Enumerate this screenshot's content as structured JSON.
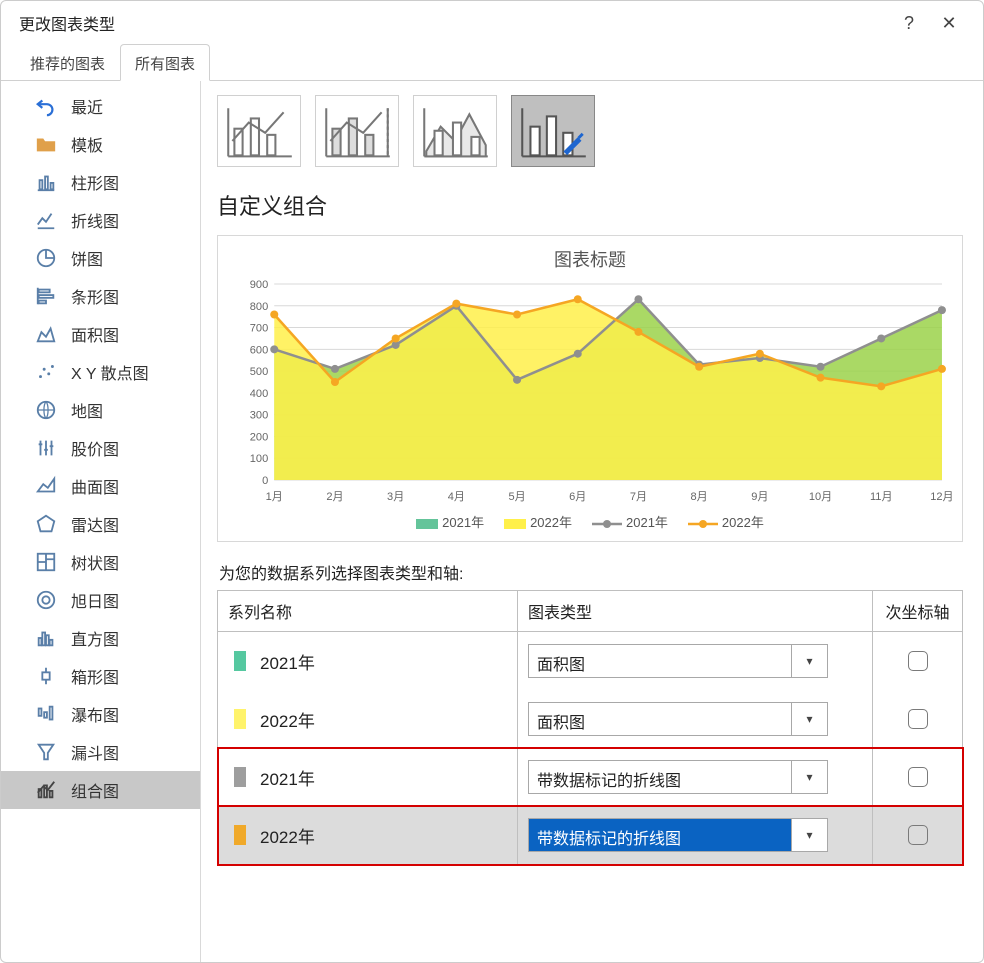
{
  "dialog": {
    "title": "更改图表类型",
    "help": "?",
    "close": "✕"
  },
  "tabs": {
    "recommended": "推荐的图表",
    "all": "所有图表"
  },
  "sidebar": {
    "items": [
      {
        "label": "最近"
      },
      {
        "label": "模板"
      },
      {
        "label": "柱形图"
      },
      {
        "label": "折线图"
      },
      {
        "label": "饼图"
      },
      {
        "label": "条形图"
      },
      {
        "label": "面积图"
      },
      {
        "label": "X Y 散点图"
      },
      {
        "label": "地图"
      },
      {
        "label": "股价图"
      },
      {
        "label": "曲面图"
      },
      {
        "label": "雷达图"
      },
      {
        "label": "树状图"
      },
      {
        "label": "旭日图"
      },
      {
        "label": "直方图"
      },
      {
        "label": "箱形图"
      },
      {
        "label": "瀑布图"
      },
      {
        "label": "漏斗图"
      },
      {
        "label": "组合图"
      }
    ]
  },
  "section_title": "自定义组合",
  "chart_title": "图表标题",
  "table": {
    "caption": "为您的数据系列选择图表类型和轴:",
    "col_name": "系列名称",
    "col_type": "图表类型",
    "col_axis": "次坐标轴",
    "rows": [
      {
        "color": "#55c8a0",
        "name": "2021年",
        "type": "面积图"
      },
      {
        "color": "#fff36b",
        "name": "2022年",
        "type": "面积图"
      },
      {
        "color": "#9e9e9e",
        "name": "2021年",
        "type": "带数据标记的折线图"
      },
      {
        "color": "#f0a92a",
        "name": "2022年",
        "type": "带数据标记的折线图"
      }
    ]
  },
  "chart_data": {
    "type": "combo",
    "title": "图表标题",
    "categories": [
      "1月",
      "2月",
      "3月",
      "4月",
      "5月",
      "6月",
      "7月",
      "8月",
      "9月",
      "10月",
      "11月",
      "12月"
    ],
    "ylim": [
      0,
      900
    ],
    "yticks": [
      0,
      100,
      200,
      300,
      400,
      500,
      600,
      700,
      800,
      900
    ],
    "series": [
      {
        "name": "2021年",
        "style": "area",
        "color": "#9bd24a",
        "values": [
          600,
          510,
          620,
          800,
          460,
          580,
          830,
          530,
          560,
          520,
          650,
          780
        ]
      },
      {
        "name": "2022年",
        "style": "area",
        "color": "#fff04a",
        "values": [
          760,
          450,
          650,
          810,
          760,
          830,
          680,
          520,
          580,
          470,
          430,
          510
        ]
      },
      {
        "name": "2021年",
        "style": "line-marker",
        "color": "#8f8f8f",
        "values": [
          600,
          510,
          620,
          800,
          460,
          580,
          830,
          530,
          560,
          520,
          650,
          780
        ]
      },
      {
        "name": "2022年",
        "style": "line-marker",
        "color": "#f5a623",
        "values": [
          760,
          450,
          650,
          810,
          760,
          830,
          680,
          520,
          580,
          470,
          430,
          510
        ]
      }
    ],
    "legend": [
      "2021年",
      "2022年",
      "2021年",
      "2022年"
    ]
  }
}
